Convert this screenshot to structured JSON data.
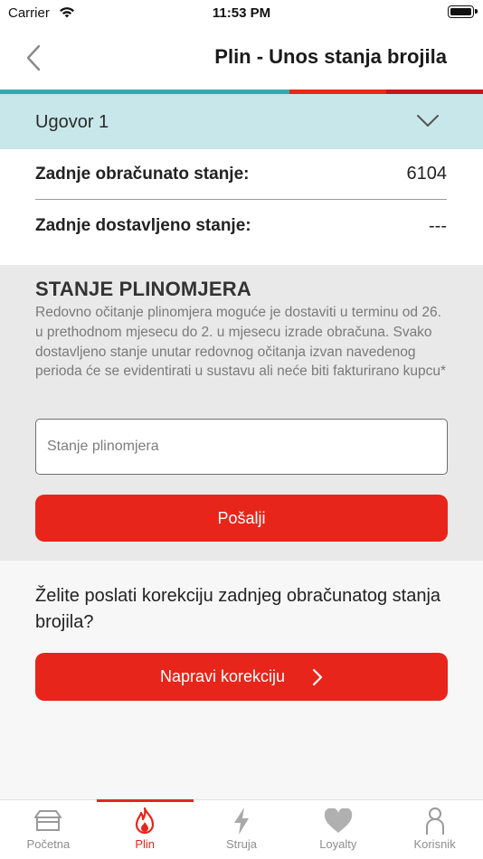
{
  "status_bar": {
    "carrier": "Carrier",
    "time": "11:53 PM"
  },
  "nav": {
    "title": "Plin - Unos stanja brojila",
    "back_icon": "chevron-left-icon"
  },
  "progress_colors": [
    "#38a8b0",
    "#e8281c",
    "#c8161f"
  ],
  "contract": {
    "label": "Ugovor 1",
    "icon": "chevron-down-icon"
  },
  "summary": {
    "last_billed_label": "Zadnje obračunato stanje:",
    "last_billed_value": "6104",
    "last_submitted_label": "Zadnje dostavljeno stanje:",
    "last_submitted_value": "---"
  },
  "meter": {
    "title": "STANJE PLINOMJERA",
    "description": "Redovno očitanje plinomjera moguće je dostaviti u terminu od 26. u prethodnom mjesecu do 2. u mjesecu izrade obračuna. Svako dostavljeno stanje unutar redovnog očitanja izvan navedenog perioda će se evidentirati u sustavu ali neće biti fakturirano kupcu*",
    "input_placeholder": "Stanje plinomjera",
    "input_value": "",
    "submit_label": "Pošalji"
  },
  "correction": {
    "question": "Želite poslati korekciju zadnjeg obračunatog stanja brojila?",
    "button_label": "Napravi korekciju"
  },
  "tabs": [
    {
      "label": "Početna",
      "icon": "home-box-icon",
      "active": false
    },
    {
      "label": "Plin",
      "icon": "flame-icon",
      "active": true
    },
    {
      "label": "Struja",
      "icon": "lightning-icon",
      "active": false
    },
    {
      "label": "Loyalty",
      "icon": "heart-icon",
      "active": false
    },
    {
      "label": "Korisnik",
      "icon": "user-icon",
      "active": false
    }
  ],
  "colors": {
    "accent_red": "#e8251a",
    "teal": "#38a8b0",
    "contract_bg": "#c8e7ea",
    "section_gray": "#e9e9e9",
    "tab_inactive": "#8e8e8e"
  }
}
